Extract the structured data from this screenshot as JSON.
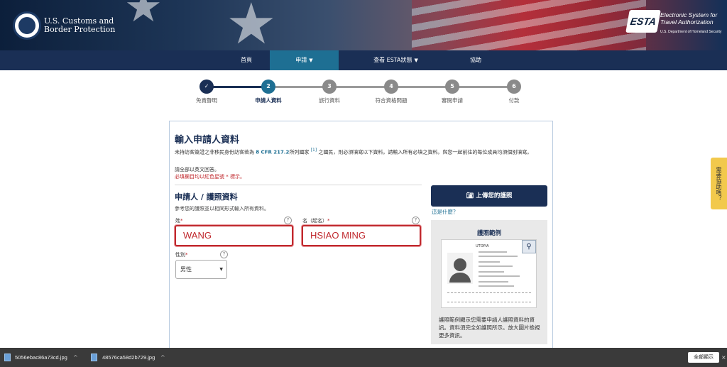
{
  "header": {
    "agency_name": "U.S. Customs and Border Protection",
    "esta_logo_text": "ESTA",
    "esta_subtitle": "Electronic System for Travel Authorization",
    "esta_dept": "U.S. Department of Homeland Security"
  },
  "nav": {
    "home": "首頁",
    "apply": "申請",
    "check_status": "查看 ESTA狀態",
    "help": "協助"
  },
  "steps": [
    {
      "number": "✓",
      "label": "免責聲明",
      "state": "done"
    },
    {
      "number": "2",
      "label": "申請人資料",
      "state": "current"
    },
    {
      "number": "3",
      "label": "旅行資料",
      "state": "todo"
    },
    {
      "number": "4",
      "label": "符合資格問題",
      "state": "todo"
    },
    {
      "number": "5",
      "label": "審閱申請",
      "state": "todo"
    },
    {
      "number": "6",
      "label": "付款",
      "state": "todo"
    }
  ],
  "form": {
    "title": "輸入申請人資料",
    "intro_a": "未持訪客簽證之非移民身份訪客若為",
    "intro_ref": "8 CFR 217.2",
    "intro_b": "所列國家",
    "intro_footnote": "[1]",
    "intro_c": "之國民，則必須填寫以下資料。請輸入所有必填之資料。與您一起前往的每位成員均須個別填寫。",
    "english_note": "請全部以英文回答。",
    "required_note": "必填欄目均以紅色星號 * 標示。",
    "section_title": "申請人 / 護照資料",
    "section_desc": "參考您的護照並以相同形式輸入所有資料。",
    "surname_label": "姓",
    "surname_value": "WANG",
    "given_label": "名（起名）",
    "given_value": "HSIAO MING",
    "gender_label": "性別",
    "gender_value": "男性",
    "asterisk": "*"
  },
  "side": {
    "upload_label": "上傳您的護照",
    "what_link": "這是什麼？",
    "sample_title": "護照範例",
    "sample_country": "UTOPIA",
    "sample_desc": "護照範例顯示您需要申請人護照資料的資訊。資料須完全如護照所示。放大圖片檢視更多資訊。"
  },
  "feedback_label": "需要協助嗎？",
  "downloads": {
    "file1": "5056ebac86a73cd.jpg",
    "file2": "48576ca58d2b729.jpg",
    "show_all": "全部顯示"
  },
  "colors": {
    "navy": "#1a2f55",
    "teal": "#1e6f93",
    "error_red": "#c0282d",
    "feedback_yellow": "#f2c94c"
  }
}
